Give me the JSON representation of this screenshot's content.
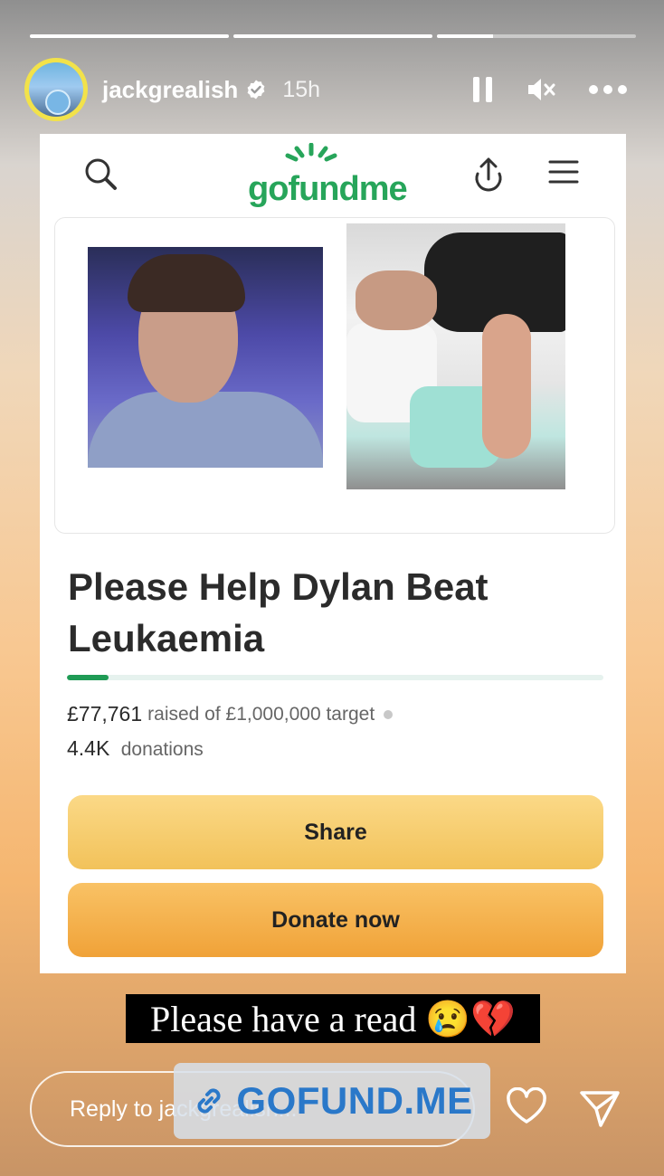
{
  "story": {
    "progress": [
      1.0,
      1.0,
      0.28,
      0.0
    ],
    "username": "jackgrealish",
    "time_ago": "15h"
  },
  "post": {
    "logo": "gofundme",
    "title": "Please Help Dylan Beat Leukaemia",
    "progress_fraction": 0.078,
    "raised_amount": "£77,761",
    "raised_text": "raised of £1,000,000 target",
    "donations_count": "4.4K",
    "donations_text": "donations",
    "share_label": "Share",
    "donate_label": "Donate now"
  },
  "caption": {
    "text": "Please have a read",
    "emojis": "😢💔"
  },
  "link_sticker": {
    "text": "GOFUND.ME"
  },
  "reply": {
    "placeholder": "Reply to jackgrealish..."
  },
  "colors": {
    "brand_green": "#27a55a",
    "share_yellow": "#f2c25a",
    "donate_orange": "#f0a238",
    "link_blue": "#2a78c9"
  },
  "icons": [
    "pause-icon",
    "mute-icon",
    "more-icon",
    "verified-icon",
    "search-icon",
    "upload-icon",
    "menu-icon",
    "link-icon",
    "heart-icon",
    "send-icon"
  ]
}
